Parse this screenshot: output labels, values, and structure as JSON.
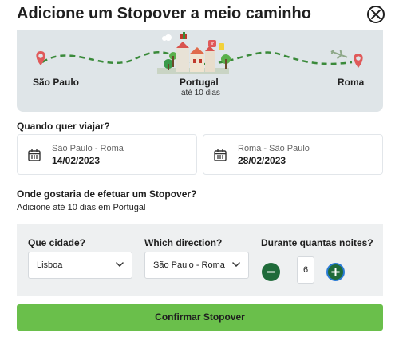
{
  "header": {
    "title": "Adicione um Stopover a meio caminho"
  },
  "route": {
    "origin": "São Paulo",
    "stopover": "Portugal",
    "stopover_note": "até 10 dias",
    "destination": "Roma"
  },
  "travel_dates": {
    "label": "Quando quer viajar?",
    "outbound": {
      "route": "São Paulo - Roma",
      "date": "14/02/2023"
    },
    "return": {
      "route": "Roma - São Paulo",
      "date": "28/02/2023"
    }
  },
  "stopover_section": {
    "label": "Onde gostaria de efetuar um Stopover?",
    "subtitle": "Adicione até 10 dias em Portugal",
    "city_label": "Que cidade?",
    "city_value": "Lisboa",
    "direction_label": "Which direction?",
    "direction_value": "São Paulo - Roma",
    "nights_label": "Durante quantas noites?",
    "nights_value": "6"
  },
  "confirm_label": "Confirmar Stopover",
  "colors": {
    "accent_green": "#6abf4b",
    "dark_green": "#1f6b3a",
    "map_pin": "#e05a5a",
    "panel_bg": "#dfe5e8"
  },
  "icons": [
    "close-icon",
    "location-pin-icon",
    "airplane-icon",
    "calendar-icon",
    "chevron-down-icon",
    "minus-icon",
    "plus-icon",
    "city-illustration"
  ]
}
